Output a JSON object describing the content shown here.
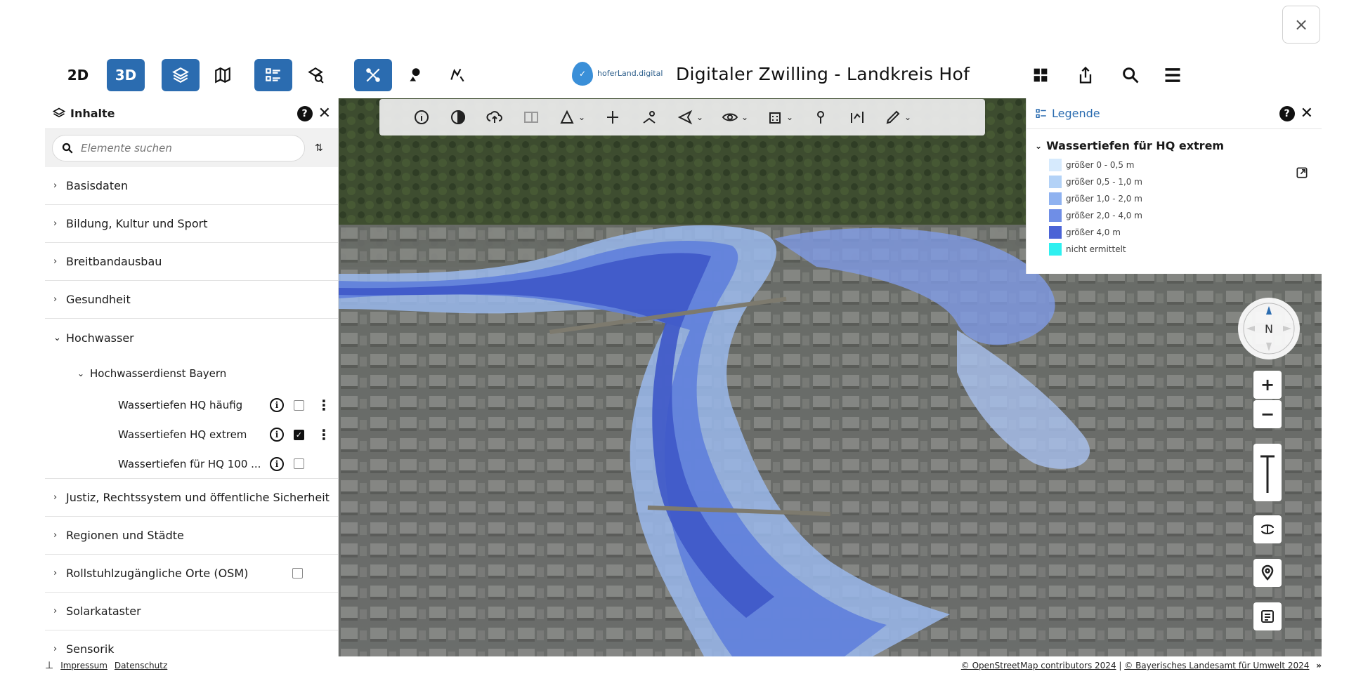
{
  "header": {
    "close_label": "×",
    "btn_2d": "2D",
    "btn_3d": "3D",
    "brand_logo_text": "hoferLand.digital",
    "title": "Digitaler Zwilling - Landkreis Hof"
  },
  "contents_panel": {
    "title": "Inhalte",
    "help": "?",
    "close": "✕",
    "search_placeholder": "Elemente suchen",
    "categories": [
      {
        "label": "Basisdaten"
      },
      {
        "label": "Bildung, Kultur und Sport"
      },
      {
        "label": "Breitbandausbau"
      },
      {
        "label": "Gesundheit"
      },
      {
        "label": "Hochwasser"
      },
      {
        "label": "Justiz, Rechtssystem und öffentliche Sicherheit"
      },
      {
        "label": "Regionen und Städte"
      },
      {
        "label": "Rollstuhlzugängliche Orte (OSM)"
      },
      {
        "label": "Solarkataster"
      },
      {
        "label": "Sensorik"
      }
    ],
    "hochwasser_sub": "Hochwasserdienst Bayern",
    "layers": [
      {
        "label": "Wassertiefen HQ häufig",
        "checked": false
      },
      {
        "label": "Wassertiefen HQ extrem",
        "checked": true
      },
      {
        "label": "Wassertiefen für HQ 100 ...",
        "checked": false
      }
    ]
  },
  "legend": {
    "title": "Legende",
    "help": "?",
    "close": "✕",
    "layer_title": "Wassertiefen für HQ extrem",
    "entries": [
      {
        "label": "größer 0 - 0,5 m",
        "color": "#d6eafd"
      },
      {
        "label": "größer 0,5 - 1,0 m",
        "color": "#b3d2f7"
      },
      {
        "label": "größer 1,0 - 2,0 m",
        "color": "#8fb2f0"
      },
      {
        "label": "größer 2,0 - 4,0 m",
        "color": "#6f8ee6"
      },
      {
        "label": "größer 4,0 m",
        "color": "#4a63d6"
      },
      {
        "label": "nicht ermittelt",
        "color": "#2ff0f0"
      }
    ]
  },
  "map_controls": {
    "compass_label": "N",
    "zoom_in": "+",
    "zoom_out": "−"
  },
  "footer": {
    "impressum": "Impressum",
    "datenschutz": "Datenschutz",
    "attribution_osm": "© OpenStreetMap contributors 2024",
    "attribution_lfu": "© Bayerisches Landesamt für Umwelt 2024",
    "attribution_sep": " | ",
    "collapse": "»"
  },
  "colors": {
    "accent": "#2b6cb0"
  }
}
